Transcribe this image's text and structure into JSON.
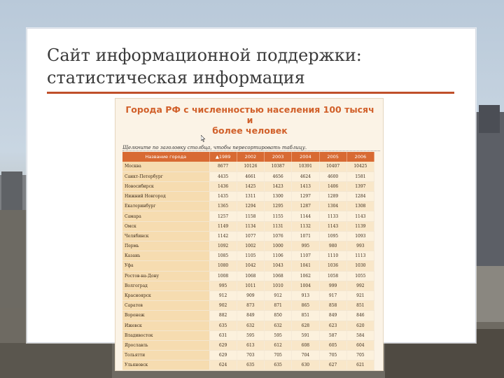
{
  "slide": {
    "title_line1": "Сайт информационной поддержки:",
    "title_line2": "статистическая информация"
  },
  "screenshot": {
    "heading_line1": "Города РФ с численностью населения 100 тысяч и",
    "heading_line2": "более человек",
    "sort_hint": "Щелкните по заголовку столбца, чтобы пересортировать таблицу.",
    "columns": [
      "Название города",
      "▲1989",
      "2002",
      "2003",
      "2004",
      "2005",
      "2006"
    ],
    "rows": [
      [
        "Москва",
        "8677",
        "10126",
        "10387",
        "10391",
        "10407",
        "10425"
      ],
      [
        "Санкт-Петербург",
        "4435",
        "4661",
        "4656",
        "4624",
        "4600",
        "1581"
      ],
      [
        "Новосибирск",
        "1436",
        "1425",
        "1423",
        "1413",
        "1406",
        "1397"
      ],
      [
        "Нижний Новгород",
        "1435",
        "1311",
        "1300",
        "1297",
        "1289",
        "1284"
      ],
      [
        "Екатеринбург",
        "1365",
        "1294",
        "1295",
        "1287",
        "1304",
        "1308"
      ],
      [
        "Самара",
        "1257",
        "1158",
        "1155",
        "1144",
        "1133",
        "1143"
      ],
      [
        "Омск",
        "1149",
        "1134",
        "1131",
        "1132",
        "1143",
        "1139"
      ],
      [
        "Челябинск",
        "1142",
        "1077",
        "1076",
        "1071",
        "1095",
        "1093"
      ],
      [
        "Пермь",
        "1092",
        "1002",
        "1000",
        "995",
        "980",
        "993"
      ],
      [
        "Казань",
        "1085",
        "1105",
        "1106",
        "1107",
        "1110",
        "1113"
      ],
      [
        "Уфа",
        "1080",
        "1042",
        "1043",
        "1041",
        "1036",
        "1030"
      ],
      [
        "Ростов-на-Дону",
        "1008",
        "1068",
        "1068",
        "1062",
        "1058",
        "1055"
      ],
      [
        "Волгоград",
        "995",
        "1011",
        "1010",
        "1004",
        "999",
        "992"
      ],
      [
        "Красноярск",
        "912",
        "909",
        "912",
        "913",
        "917",
        "921"
      ],
      [
        "Саратов",
        "902",
        "873",
        "871",
        "865",
        "858",
        "851"
      ],
      [
        "Воронеж",
        "882",
        "849",
        "850",
        "851",
        "849",
        "846"
      ],
      [
        "Ижевск",
        "635",
        "632",
        "632",
        "628",
        "623",
        "620"
      ],
      [
        "Владивосток",
        "631",
        "595",
        "595",
        "591",
        "587",
        "584"
      ],
      [
        "Ярославль",
        "629",
        "613",
        "612",
        "608",
        "605",
        "604"
      ],
      [
        "Тольятти",
        "629",
        "703",
        "705",
        "704",
        "705",
        "705"
      ],
      [
        "Ульяновск",
        "624",
        "635",
        "635",
        "630",
        "627",
        "621"
      ]
    ]
  },
  "colors": {
    "accent": "#c0502a",
    "table_header": "#d86a33",
    "heading_orange": "#d1602a"
  }
}
